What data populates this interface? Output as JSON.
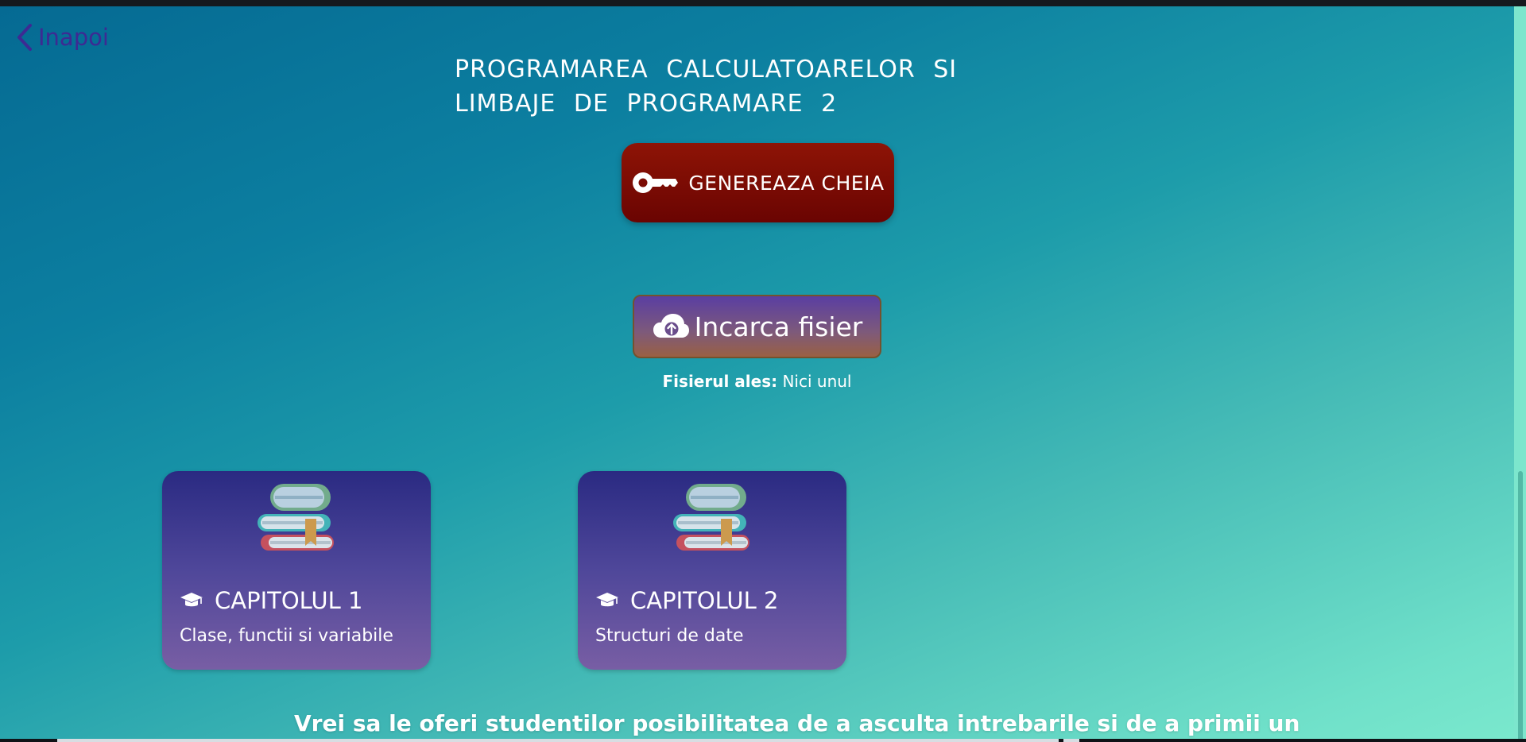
{
  "nav": {
    "back_label": "Inapoi"
  },
  "page": {
    "title": "PROGRAMAREA CALCULATOARELOR SI LIMBAJE DE PROGRAMARE 2"
  },
  "actions": {
    "generate_key_label": "GENEREAZA CHEIA",
    "upload_label": "Incarca fisier",
    "file_label": "Fisierul ales:",
    "file_value": "Nici unul"
  },
  "chapters": [
    {
      "title": "CAPITOLUL 1",
      "subtitle": "Clase, functii si variabile"
    },
    {
      "title": "CAPITOLUL 2",
      "subtitle": "Structuri de date"
    }
  ],
  "promo": {
    "text": "Vrei sa le oferi studentilor posibilitatea de a asculta intrebarile si de a primii un"
  },
  "colors": {
    "background_start": "#056a93",
    "background_end": "#7ae8cd",
    "generate_button": "#8e1406",
    "card": "#4f479a",
    "back_link": "#3d2a93"
  },
  "icons": {
    "back": "chevron-left-icon",
    "key": "key-icon",
    "upload": "cloud-upload-icon",
    "books": "books-icon",
    "chapter": "graduation-cap-icon"
  }
}
